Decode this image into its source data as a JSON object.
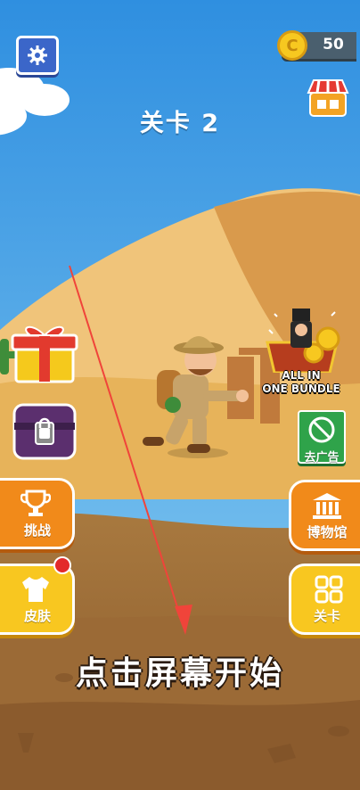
{
  "colors": {
    "sky": "#3f9fe0",
    "sand": "#e7b35a",
    "ground": "#a27642",
    "orange_button": "#f18a1a",
    "yellow_button": "#f8c720",
    "green_button": "#2fa34a",
    "settings_blue": "#3b66c9"
  },
  "header": {
    "settings_icon": "gear-icon",
    "coin_icon": "coin-icon",
    "coin_count": "50",
    "shop_icon": "shop-icon"
  },
  "level": {
    "title": "关卡 2"
  },
  "left_menu": {
    "gift_icon": "gift-icon",
    "locked_chest_icon": "locked-chest-icon",
    "challenge_label": "挑战",
    "skins_label": "皮肤"
  },
  "right_menu": {
    "bundle_label_line1": "ALL IN",
    "bundle_label_line2": "ONE BUNDLE",
    "no_ads_label": "去广告",
    "museum_label": "博物馆",
    "levels_label": "关卡"
  },
  "hint": {
    "text": "点击屏幕开始"
  }
}
